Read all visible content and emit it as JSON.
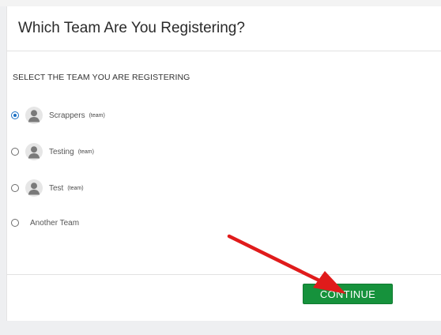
{
  "card": {
    "title": "Which Team Are You Registering?",
    "section_label": "SELECT THE TEAM YOU ARE REGISTERING"
  },
  "options": [
    {
      "name": "Scrappers",
      "tag": "(team)",
      "selected": true,
      "avatar_icon": "user-avatar-icon"
    },
    {
      "name": "Testing",
      "tag": "(team)",
      "selected": false,
      "avatar_icon": "user-avatar-icon"
    },
    {
      "name": "Test",
      "tag": "(team)",
      "selected": false,
      "avatar_icon": "user-avatar-icon"
    },
    {
      "name": "Another Team",
      "selected": false
    }
  ],
  "footer": {
    "continue_label": "CONTINUE"
  },
  "colors": {
    "continue_button": "#16923c",
    "radio_selected": "#1a6fc4",
    "annotation_arrow": "#e01b1b"
  }
}
